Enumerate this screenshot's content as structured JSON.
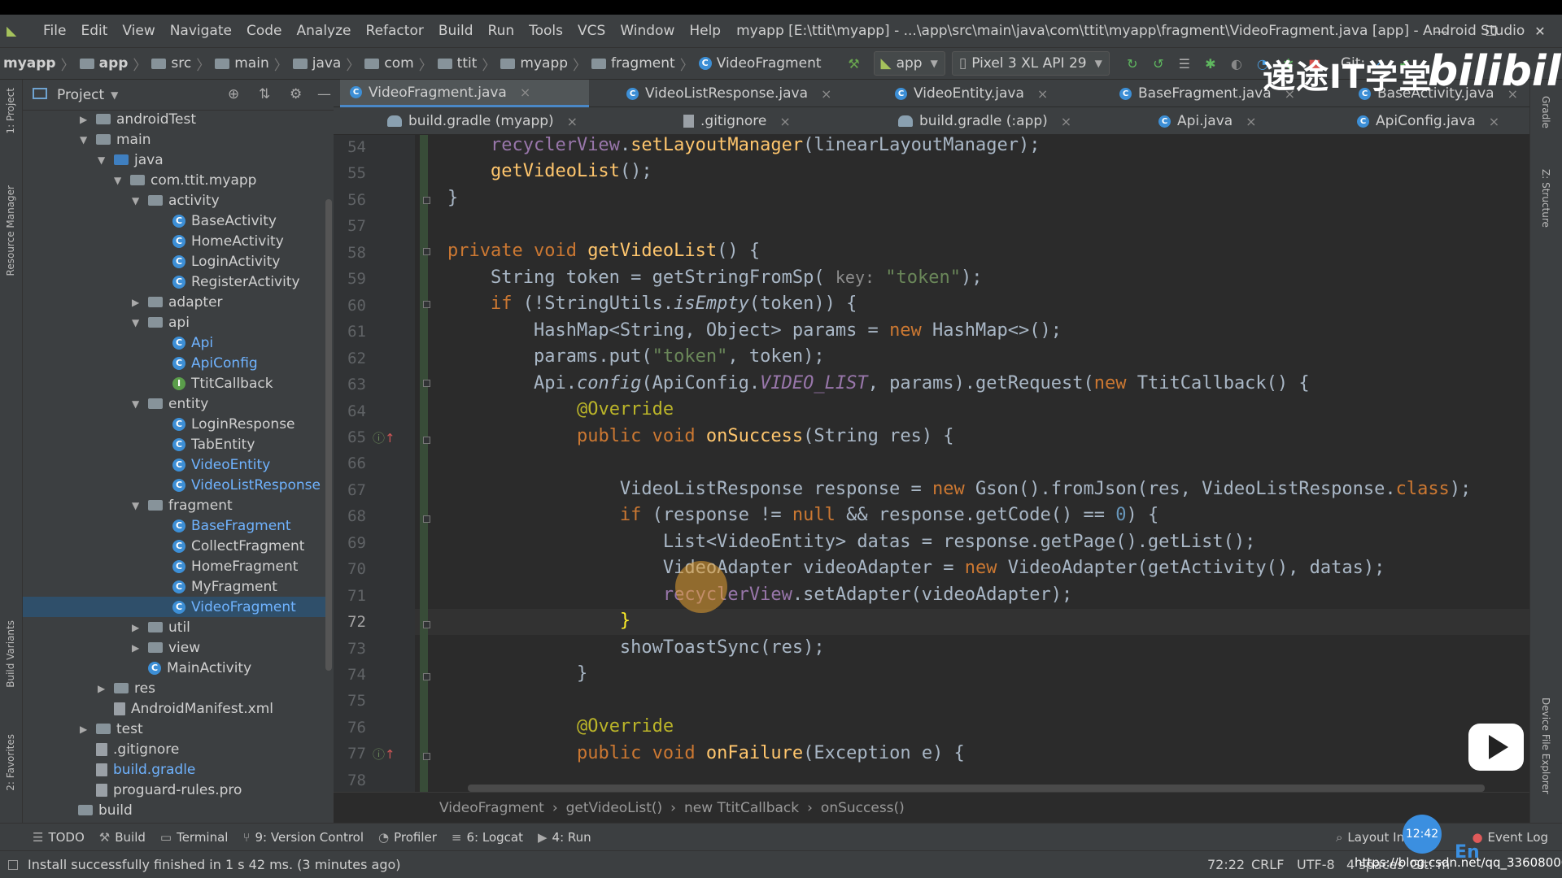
{
  "window": {
    "title": "myapp [E:\\ttit\\myapp] - ...\\app\\src\\main\\java\\com\\ttit\\myapp\\fragment\\VideoFragment.java [app] - Android Studio"
  },
  "menu": [
    "File",
    "Edit",
    "View",
    "Navigate",
    "Code",
    "Analyze",
    "Refactor",
    "Build",
    "Run",
    "Tools",
    "VCS",
    "Window",
    "Help"
  ],
  "breadcrumb": [
    "myapp",
    "app",
    "src",
    "main",
    "java",
    "com",
    "ttit",
    "myapp",
    "fragment",
    "VideoFragment"
  ],
  "toolbar": {
    "run_config": "app",
    "device": "Pixel 3 XL API 29",
    "git_label": "Git:"
  },
  "project_panel": {
    "title": "Project",
    "tree": [
      {
        "label": "androidTest",
        "kind": "folder",
        "depth": 0,
        "arrow": "▶"
      },
      {
        "label": "main",
        "kind": "folder",
        "depth": 0,
        "arrow": "▼"
      },
      {
        "label": "java",
        "kind": "folder-blue",
        "depth": 1,
        "arrow": "▼"
      },
      {
        "label": "com.ttit.myapp",
        "kind": "folder",
        "depth": 2,
        "arrow": "▼"
      },
      {
        "label": "activity",
        "kind": "folder",
        "depth": 3,
        "arrow": "▼"
      },
      {
        "label": "BaseActivity",
        "kind": "class",
        "depth": 4
      },
      {
        "label": "HomeActivity",
        "kind": "class",
        "depth": 4
      },
      {
        "label": "LoginActivity",
        "kind": "class",
        "depth": 4
      },
      {
        "label": "RegisterActivity",
        "kind": "class",
        "depth": 4
      },
      {
        "label": "adapter",
        "kind": "folder",
        "depth": 3,
        "arrow": "▶"
      },
      {
        "label": "api",
        "kind": "folder",
        "depth": 3,
        "arrow": "▼"
      },
      {
        "label": "Api",
        "kind": "class",
        "depth": 4,
        "blue": true
      },
      {
        "label": "ApiConfig",
        "kind": "class",
        "depth": 4,
        "blue": true
      },
      {
        "label": "TtitCallback",
        "kind": "interface",
        "depth": 4
      },
      {
        "label": "entity",
        "kind": "folder",
        "depth": 3,
        "arrow": "▼"
      },
      {
        "label": "LoginResponse",
        "kind": "class",
        "depth": 4
      },
      {
        "label": "TabEntity",
        "kind": "class",
        "depth": 4
      },
      {
        "label": "VideoEntity",
        "kind": "class",
        "depth": 4,
        "blue": true
      },
      {
        "label": "VideoListResponse",
        "kind": "class",
        "depth": 4,
        "blue": true
      },
      {
        "label": "fragment",
        "kind": "folder",
        "depth": 3,
        "arrow": "▼"
      },
      {
        "label": "BaseFragment",
        "kind": "class",
        "depth": 4,
        "blue": true
      },
      {
        "label": "CollectFragment",
        "kind": "class",
        "depth": 4
      },
      {
        "label": "HomeFragment",
        "kind": "class",
        "depth": 4
      },
      {
        "label": "MyFragment",
        "kind": "class",
        "depth": 4
      },
      {
        "label": "VideoFragment",
        "kind": "class",
        "depth": 4,
        "blue": true,
        "selected": true
      },
      {
        "label": "util",
        "kind": "folder",
        "depth": 3,
        "arrow": "▶"
      },
      {
        "label": "view",
        "kind": "folder",
        "depth": 3,
        "arrow": "▶"
      },
      {
        "label": "MainActivity",
        "kind": "class",
        "depth": 3
      },
      {
        "label": "res",
        "kind": "folder",
        "depth": 1,
        "arrow": "▶"
      },
      {
        "label": "AndroidManifest.xml",
        "kind": "file",
        "depth": 1
      },
      {
        "label": "test",
        "kind": "folder",
        "depth": 0,
        "arrow": "▶"
      },
      {
        "label": ".gitignore",
        "kind": "file",
        "depth": -1
      },
      {
        "label": "build.gradle",
        "kind": "file",
        "depth": -1,
        "blue": true
      },
      {
        "label": "proguard-rules.pro",
        "kind": "file",
        "depth": -1
      },
      {
        "label": "build",
        "kind": "folder",
        "depth": -2
      }
    ]
  },
  "tabs_row1": [
    {
      "label": "VideoFragment.java",
      "icon": "class",
      "active": true
    },
    {
      "label": "VideoListResponse.java",
      "icon": "class"
    },
    {
      "label": "VideoEntity.java",
      "icon": "class"
    },
    {
      "label": "BaseFragment.java",
      "icon": "class"
    },
    {
      "label": "BaseActivity.java",
      "icon": "class"
    }
  ],
  "tabs_row2": [
    {
      "label": "build.gradle (myapp)",
      "icon": "gradle"
    },
    {
      "label": ".gitignore",
      "icon": "file"
    },
    {
      "label": "build.gradle (:app)",
      "icon": "gradle"
    },
    {
      "label": "Api.java",
      "icon": "class"
    },
    {
      "label": "ApiConfig.java",
      "icon": "class"
    }
  ],
  "editor": {
    "line_numbers": [
      "54",
      "55",
      "56",
      "57",
      "58",
      "59",
      "60",
      "61",
      "62",
      "63",
      "64",
      "65",
      "66",
      "67",
      "68",
      "69",
      "70",
      "71",
      "72",
      "73",
      "74",
      "75",
      "76",
      "77",
      "78"
    ],
    "current_line": "72",
    "breadcrumb": [
      "VideoFragment",
      "getVideoList()",
      "new TtitCallback",
      "onSuccess()"
    ]
  },
  "left_strip_labels": [
    "1: Project",
    "Resource Manager",
    "Build Variants",
    "2: Favorites"
  ],
  "right_strip_labels": [
    "Gradle",
    "Z: Structure",
    "Device File Explorer"
  ],
  "tool_windows": [
    "TODO",
    "Build",
    "Terminal",
    "9: Version Control",
    "Profiler",
    "6: Logcat",
    "4: Run"
  ],
  "tool_windows_right": [
    "Layout Insp",
    "Event Log"
  ],
  "status": {
    "message": "Install successfully finished in 1 s 42 ms. (3 minutes ago)",
    "position": "72:22",
    "line_sep": "CRLF",
    "encoding": "UTF-8",
    "indent": "4 spaces",
    "git": "Git: m"
  },
  "overlay": {
    "watermark": "递途IT学堂",
    "bili": "bilibili",
    "clock": "12:42",
    "ime": "En",
    "url": "https://blog.csdn.net/qq_33608000"
  }
}
